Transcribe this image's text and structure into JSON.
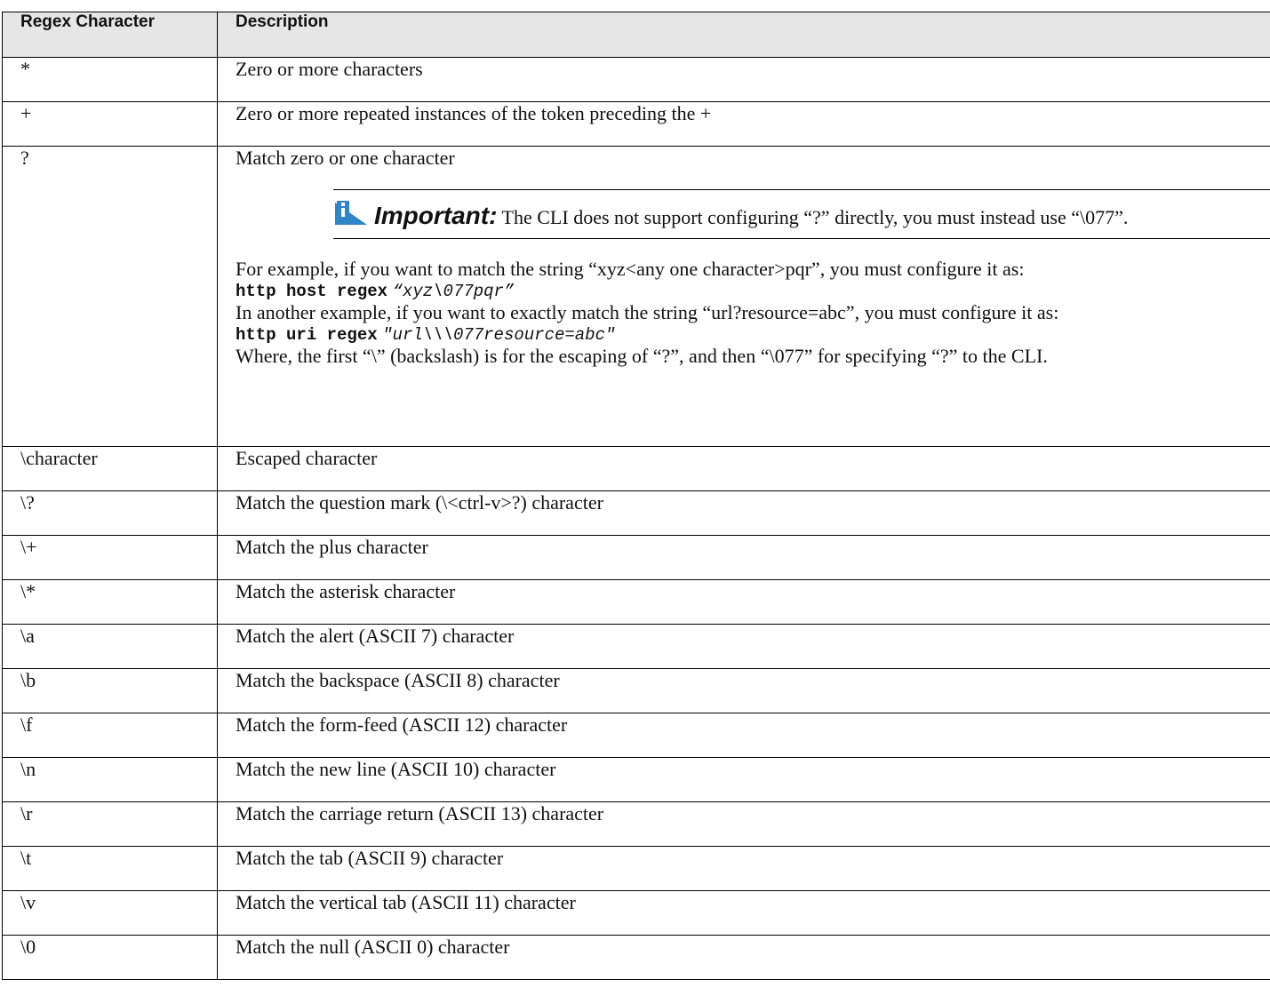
{
  "header": {
    "col1": "Regex Character",
    "col2": "Description"
  },
  "rows_before": [
    {
      "char": "*",
      "desc": "Zero or more characters"
    },
    {
      "char": "+",
      "desc": "Zero or more repeated instances of the token preceding the +"
    }
  ],
  "question_row": {
    "char": "?",
    "desc": "Match zero or one character",
    "note_label": "Important:",
    "note_text": "The CLI does not support configuring “?” directly, you must instead use “\\077”.",
    "example1_text": "For example, if you want to match the string “xyz<any one character>pqr”, you must configure it as:",
    "example1_cmd": "http host regex",
    "example1_arg": "“xyz\\077pqr”",
    "example2_text": "In another example, if you want to exactly match the string “url?resource=abc”, you must configure it as:",
    "example2_cmd": "http uri regex",
    "example2_arg": "\"url\\\\\\077resource=abc\"",
    "explanation": "Where, the first “\\” (backslash) is for the escaping of “?”, and then “\\077” for specifying “?” to the CLI."
  },
  "rows_after": [
    {
      "char": "\\character",
      "desc": "Escaped character"
    },
    {
      "char": "\\?",
      "desc": "Match the question mark (\\<ctrl-v>?) character"
    },
    {
      "char": "\\+",
      "desc": "Match the plus character"
    },
    {
      "char": "\\*",
      "desc": "Match the asterisk character"
    },
    {
      "char": "\\a",
      "desc": "Match the alert (ASCII 7) character"
    },
    {
      "char": "\\b",
      "desc": "Match the backspace (ASCII 8) character"
    },
    {
      "char": "\\f",
      "desc": "Match the form-feed (ASCII 12) character"
    },
    {
      "char": "\\n",
      "desc": "Match the new line (ASCII 10) character"
    },
    {
      "char": "\\r",
      "desc": "Match the carriage return (ASCII 13) character"
    },
    {
      "char": "\\t",
      "desc": "Match the tab (ASCII 9) character"
    },
    {
      "char": "\\v",
      "desc": "Match the vertical tab (ASCII 11) character"
    },
    {
      "char": "\\0",
      "desc": "Match the null (ASCII 0) character"
    }
  ],
  "colors": {
    "header_bg": "#e6e6e6",
    "icon_blue": "#2e86c8",
    "border": "#000000"
  },
  "icons": {
    "note_icon": "info-pointer-icon"
  }
}
